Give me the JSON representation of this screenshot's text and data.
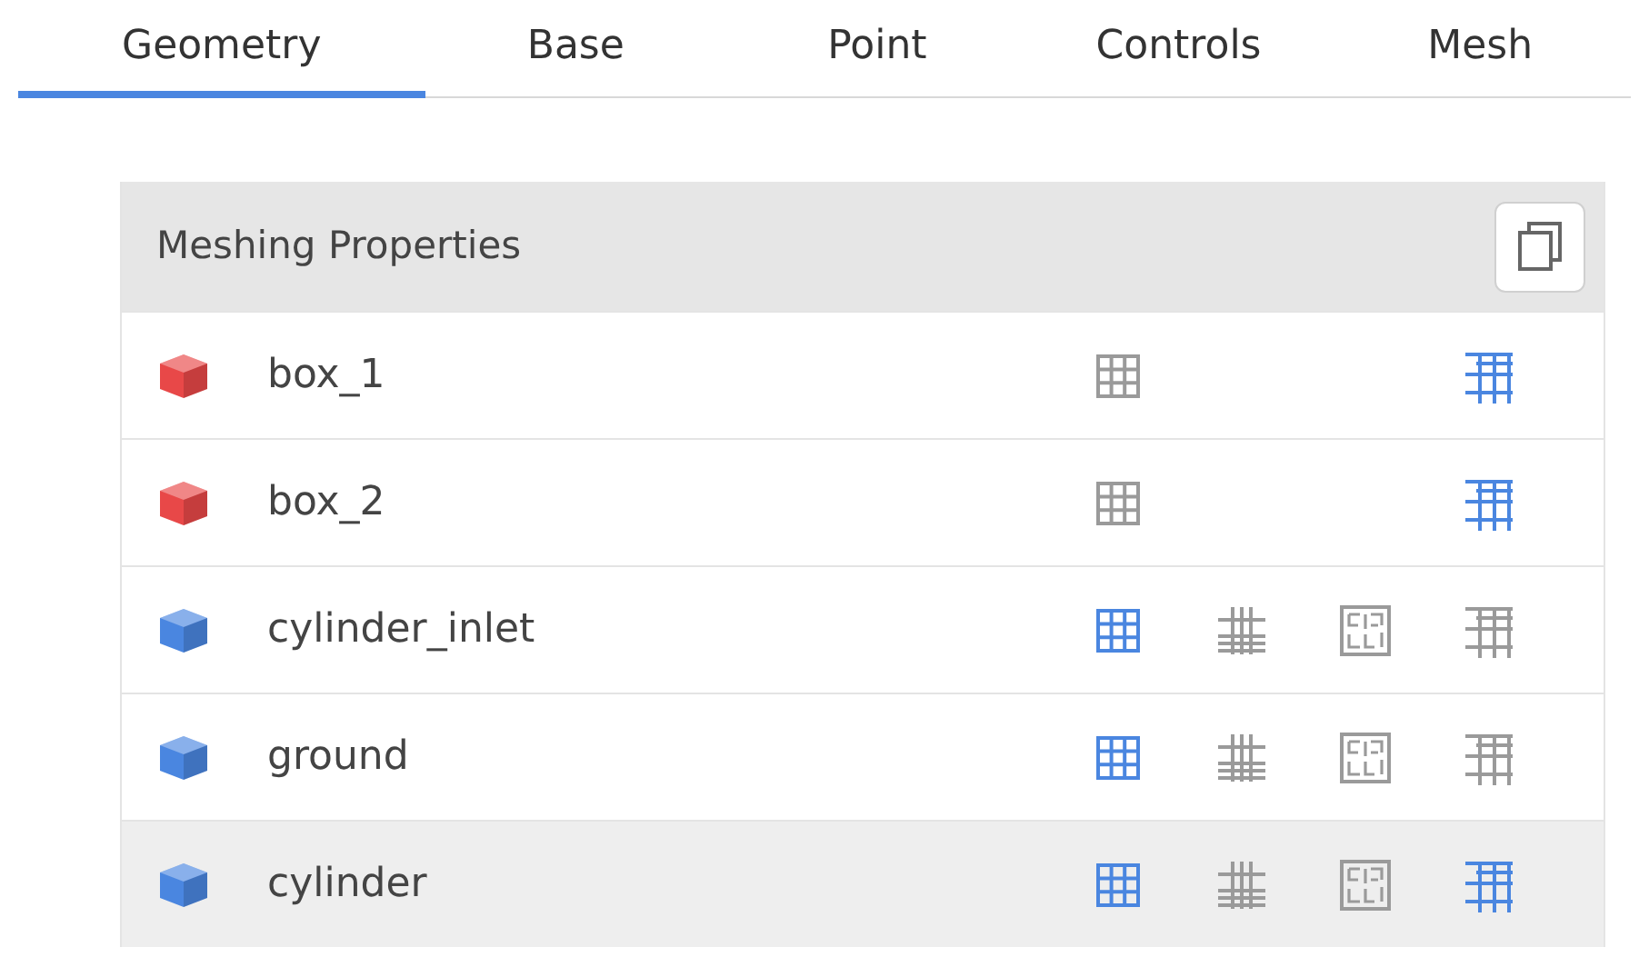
{
  "tabs": [
    {
      "label": "Geometry",
      "selected": true
    },
    {
      "label": "Base",
      "selected": false
    },
    {
      "label": "Point",
      "selected": false
    },
    {
      "label": "Controls",
      "selected": false
    },
    {
      "label": "Mesh",
      "selected": false
    }
  ],
  "panel": {
    "title": "Meshing Properties",
    "rows": [
      {
        "name": "box_1",
        "color": "#e84848",
        "selected": false,
        "controls": [
          {
            "kind": "uniform",
            "on": false
          },
          {
            "kind": "boundary",
            "on": true
          }
        ]
      },
      {
        "name": "box_2",
        "color": "#e84848",
        "selected": false,
        "controls": [
          {
            "kind": "uniform",
            "on": false
          },
          {
            "kind": "boundary",
            "on": true
          }
        ]
      },
      {
        "name": "cylinder_inlet",
        "color": "#4a86e0",
        "selected": false,
        "controls": [
          {
            "kind": "uniform",
            "on": true
          },
          {
            "kind": "refine",
            "on": false
          },
          {
            "kind": "complex",
            "on": false
          },
          {
            "kind": "boundary",
            "on": false
          }
        ]
      },
      {
        "name": "ground",
        "color": "#4a86e0",
        "selected": false,
        "controls": [
          {
            "kind": "uniform",
            "on": true
          },
          {
            "kind": "refine",
            "on": false
          },
          {
            "kind": "complex",
            "on": false
          },
          {
            "kind": "boundary",
            "on": false
          }
        ]
      },
      {
        "name": "cylinder",
        "color": "#4a86e0",
        "selected": true,
        "controls": [
          {
            "kind": "uniform",
            "on": true
          },
          {
            "kind": "refine",
            "on": false
          },
          {
            "kind": "complex",
            "on": false
          },
          {
            "kind": "boundary",
            "on": true
          }
        ]
      }
    ]
  }
}
